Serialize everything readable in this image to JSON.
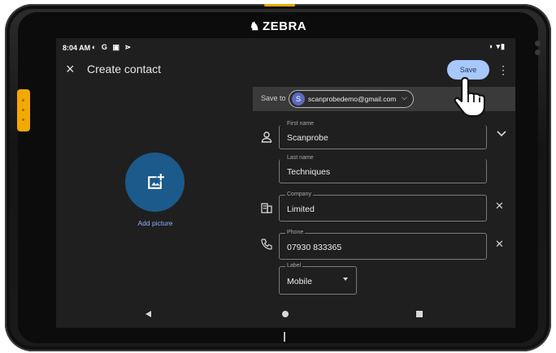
{
  "device": {
    "brand": "ZEBRA"
  },
  "status_bar": {
    "time": "8:04 AM",
    "left_icons": "◐ G ▣ ⋗",
    "right_icons": "◑ ▾▮"
  },
  "app_bar": {
    "close_glyph": "×",
    "title": "Create contact",
    "save_label": "Save",
    "more_glyph": "⋮"
  },
  "save_to": {
    "label": "Save to",
    "account_initial": "S",
    "account_email": "scanprobedemo@gmail.com"
  },
  "photo": {
    "add_label": "Add picture"
  },
  "fields": {
    "first_name": {
      "label": "First name",
      "value": "Scanprobe"
    },
    "last_name": {
      "label": "Last name",
      "value": "Techniques"
    },
    "company": {
      "label": "Company",
      "value": "Limited"
    },
    "phone": {
      "label": "Phone",
      "value": "07930 833365"
    },
    "phone_type": {
      "label": "Label",
      "value": "Mobile"
    }
  },
  "colors": {
    "accent": "#a8c7fa",
    "avatar_bg": "#1b5a8a",
    "zebra_yellow": "#f2a900"
  }
}
